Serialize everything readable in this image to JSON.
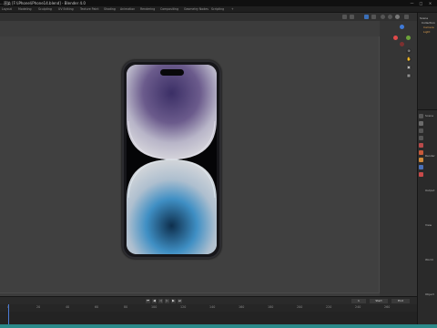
{
  "window": {
    "title": "...渲染 [F:\\iPhone\\iPhone14.blend] - Blender 4.0",
    "minimize": "—",
    "maximize": "□",
    "close": "×"
  },
  "menu": {
    "items": [
      "Layout",
      "Modeling",
      "Sculpting",
      "UV Editing",
      "Texture Paint",
      "Shading",
      "Animation",
      "Rendering",
      "Compositing",
      "Geometry Nodes",
      "Scripting",
      "+"
    ]
  },
  "outliner": {
    "rows": [
      "Scene",
      "Collection",
      "Camera",
      "Light"
    ]
  },
  "timeline": {
    "ticks": [
      "0",
      "20",
      "40",
      "60",
      "80",
      "100",
      "120",
      "140",
      "160",
      "180",
      "200",
      "220",
      "240",
      "260"
    ],
    "start_label": "Start",
    "end_label": "End",
    "current_frame": "1"
  },
  "properties": {
    "labels": [
      "Scene",
      "Render",
      "Output",
      "View",
      "World",
      "Object"
    ]
  },
  "colors": {
    "status_bar": "#2a8a8a",
    "gizmo_x": "#e04a4a",
    "gizmo_y": "#6ca33a",
    "gizmo_z": "#3f7ad8"
  }
}
